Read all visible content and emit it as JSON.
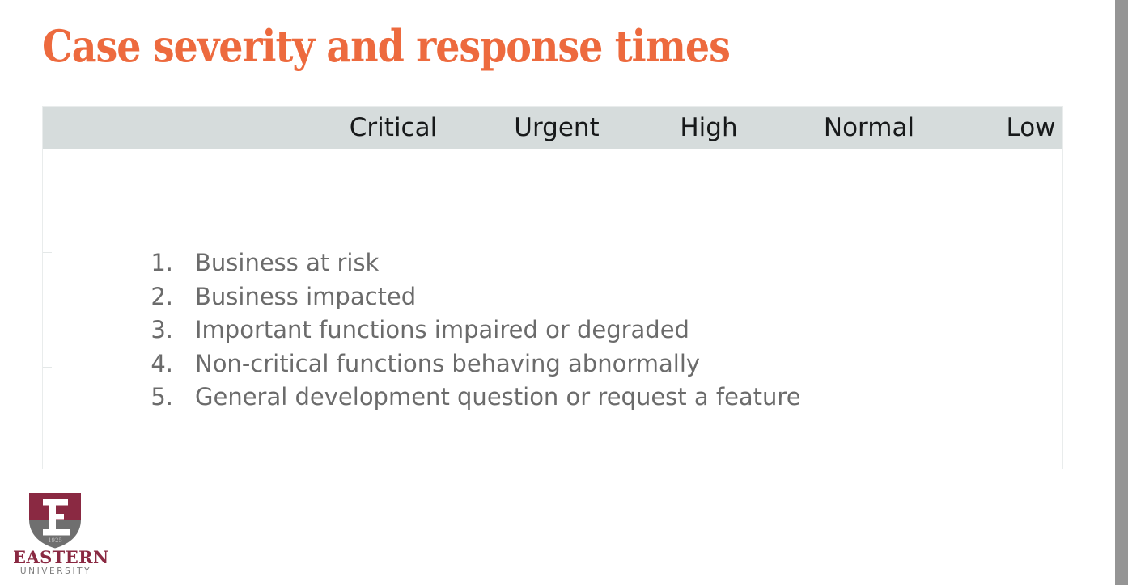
{
  "slide": {
    "title": "Case severity and response times",
    "background_color": "#ffffff",
    "title_color": "#ED6A3E"
  },
  "right_rail": {
    "name": "page-edge-rail",
    "color": "#959595"
  },
  "table": {
    "header_background": "#d6dcdc",
    "header_text_color": "#17191a",
    "border_color": "#e9ecec",
    "columns": [
      {
        "label": "Critical"
      },
      {
        "label": "Urgent"
      },
      {
        "label": "High"
      },
      {
        "label": "Normal"
      },
      {
        "label": "Low"
      }
    ],
    "row_separators": [
      127,
      269,
      359
    ]
  },
  "severity_list": {
    "text_color": "#6b6b6b",
    "items": [
      {
        "number": "1.",
        "text": "Business at risk"
      },
      {
        "number": "2.",
        "text": "Business impacted"
      },
      {
        "number": "3.",
        "text": "Important functions impaired or degraded"
      },
      {
        "number": "4.",
        "text": "Non-critical functions behaving abnormally"
      },
      {
        "number": "5.",
        "text": "General development question or request a feature"
      }
    ]
  },
  "logo": {
    "shield_top_color": "#8A2942",
    "shield_bottom_color": "#6F6F6F",
    "letter": "E",
    "year": "1925",
    "name_primary": "EASTERN",
    "name_secondary": "UNIVERSITY"
  }
}
